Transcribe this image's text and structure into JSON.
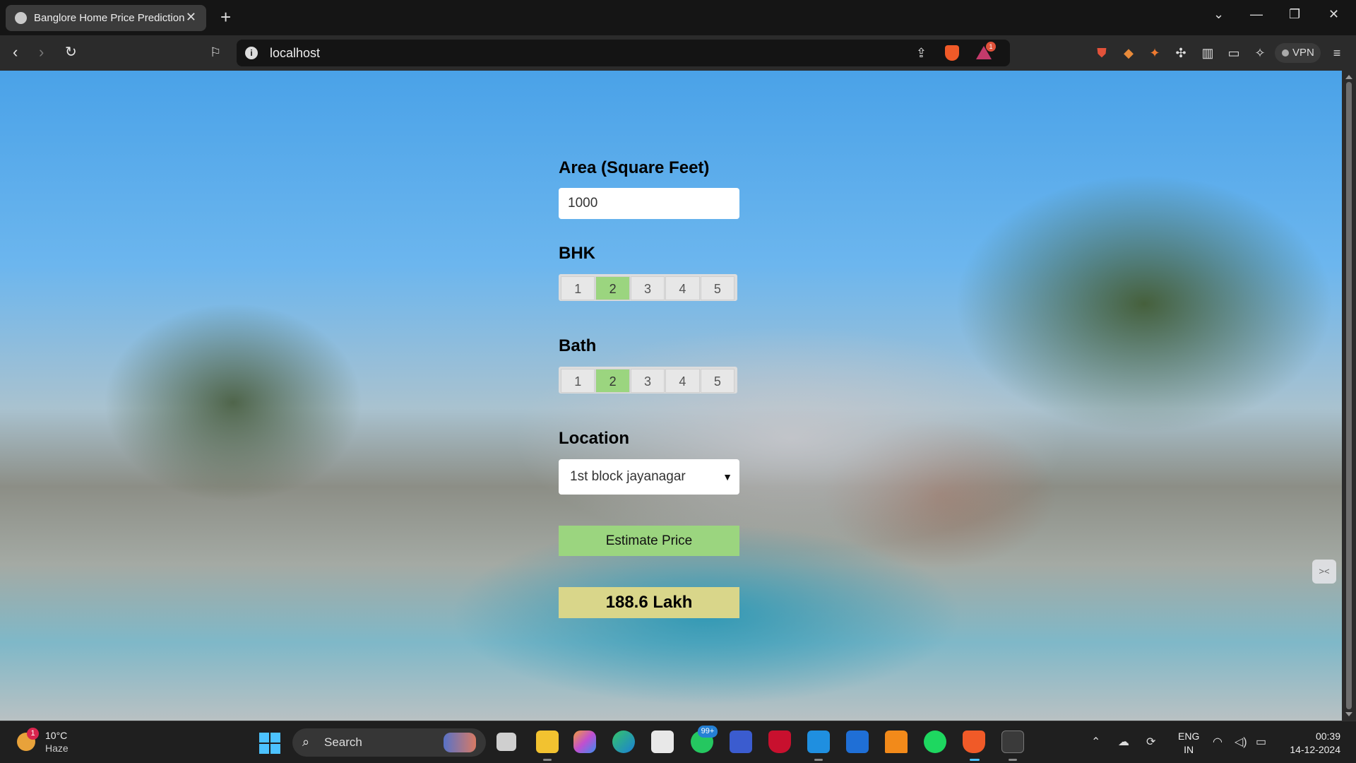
{
  "browser": {
    "tab_title": "Banglore Home Price Prediction",
    "url": "localhost",
    "rewards_badge": "1",
    "vpn_label": "VPN"
  },
  "form": {
    "area_label": "Area (Square Feet)",
    "area_value": "1000",
    "bhk_label": "BHK",
    "bhk_options": [
      "1",
      "2",
      "3",
      "4",
      "5"
    ],
    "bhk_selected": "2",
    "bath_label": "Bath",
    "bath_options": [
      "1",
      "2",
      "3",
      "4",
      "5"
    ],
    "bath_selected": "2",
    "location_label": "Location",
    "location_selected": "1st block jayanagar",
    "estimate_button": "Estimate Price",
    "result": "188.6 Lakh"
  },
  "taskbar": {
    "weather_badge": "1",
    "weather_temp": "10°C",
    "weather_condition": "Haze",
    "search_placeholder": "Search",
    "whatsapp_badge": "99+",
    "language": "ENG",
    "region": "IN",
    "time": "00:39",
    "date": "14-12-2024"
  },
  "colors": {
    "selected_option": "#9bd57f",
    "estimate_button": "#9bd57f",
    "result_bg": "#d9d68a",
    "accent_blue": "#4cc2ff"
  }
}
